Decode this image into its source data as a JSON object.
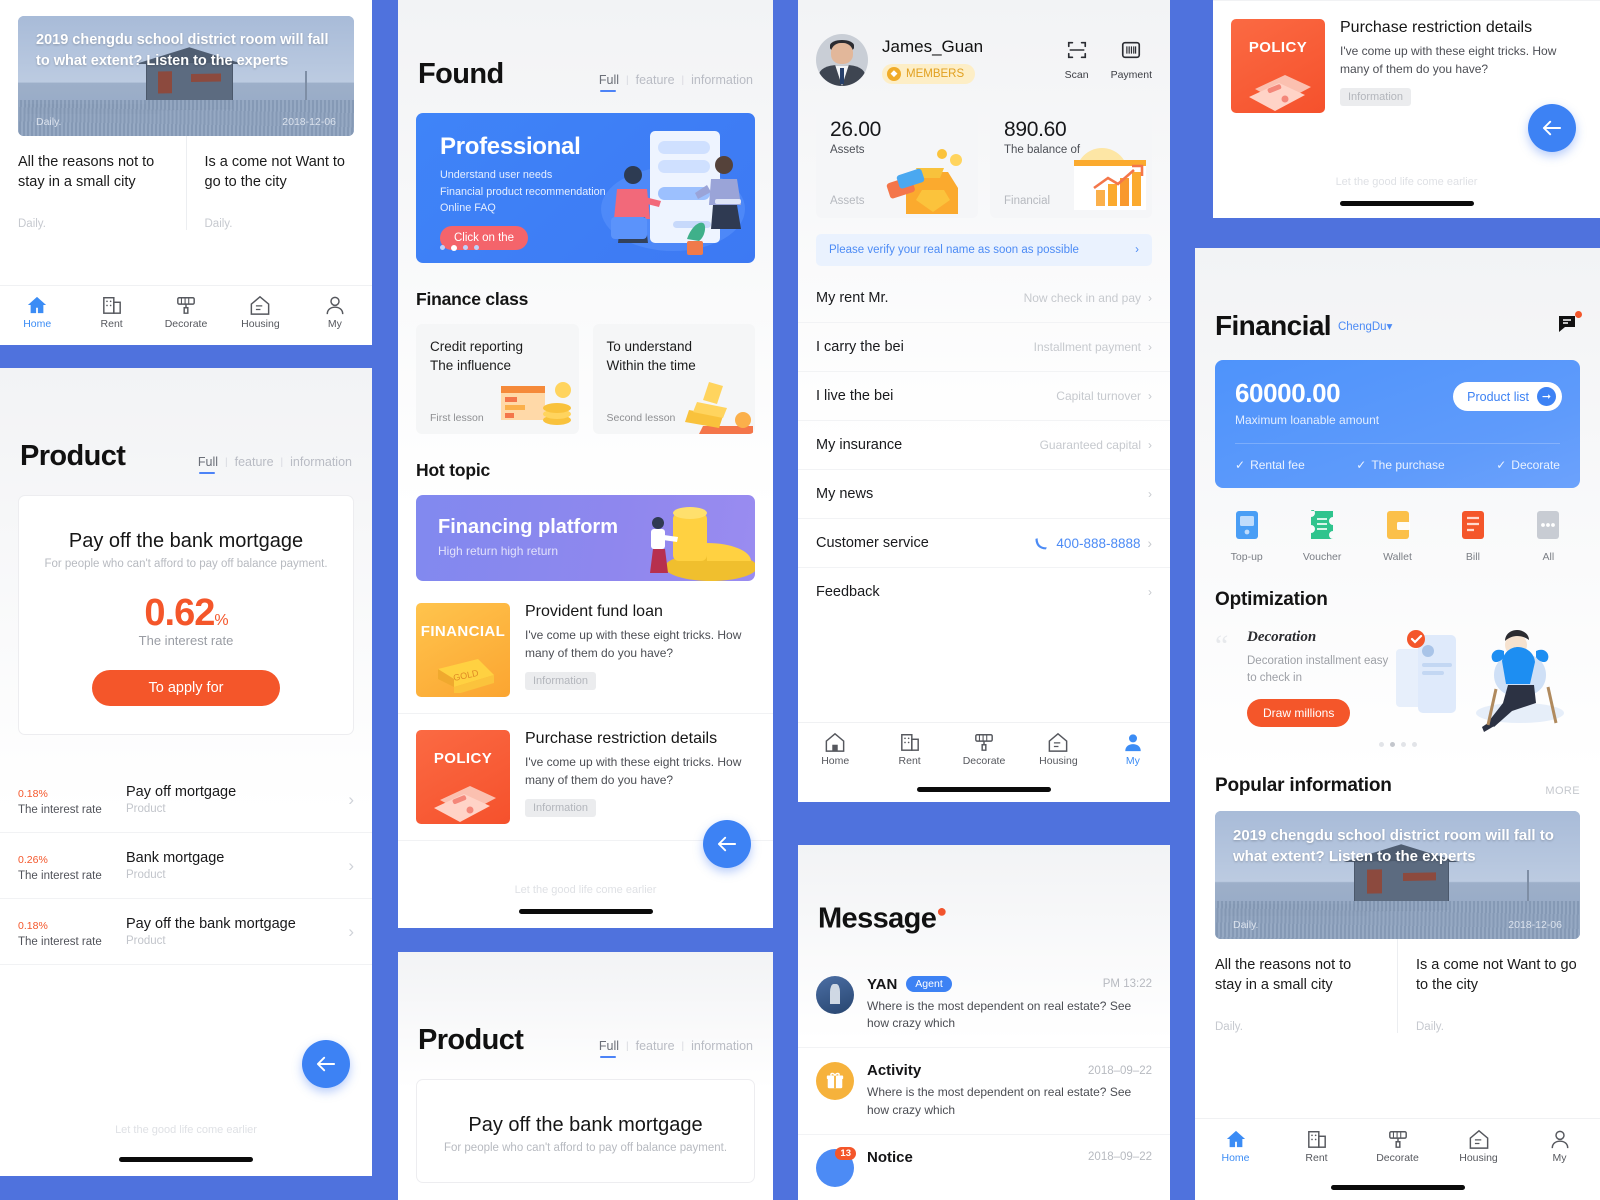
{
  "common": {
    "tabs_full": "Full",
    "tabs_feature": "feature",
    "tabs_information": "information",
    "footnote": "Let the good life come earlier",
    "chevron": "›",
    "back_arrow": "←"
  },
  "bottom_nav": {
    "items": [
      {
        "label": "Home",
        "icon": "home-icon"
      },
      {
        "label": "Rent",
        "icon": "building-icon"
      },
      {
        "label": "Decorate",
        "icon": "paint-roller-icon"
      },
      {
        "label": "Housing",
        "icon": "house-doc-icon"
      },
      {
        "label": "My",
        "icon": "person-icon"
      }
    ],
    "active_home": "Home",
    "active_my": "My"
  },
  "news": {
    "hero_title": "2019 chengdu school district room will fall to what extent? Listen to the experts",
    "hero_source": "Daily.",
    "hero_date": "2018-12-06",
    "items": [
      {
        "title": "All the reasons not to stay in a small city",
        "source": "Daily."
      },
      {
        "title": "Is a come not Want to go to the city",
        "source": "Daily."
      }
    ]
  },
  "product": {
    "title": "Product",
    "card": {
      "name": "Pay off the bank mortgage",
      "desc": "For people who can't afford to pay off balance payment.",
      "rate": "0.62",
      "rate_unit": "%",
      "rate_label": "The interest rate",
      "apply_label": "To apply for"
    },
    "rows": [
      {
        "rate": "0.18",
        "unit": "%",
        "rate_label": "The interest rate",
        "title": "Pay off  mortgage",
        "desc": "Product"
      },
      {
        "rate": "0.26",
        "unit": "%",
        "rate_label": "The interest rate",
        "title": "Bank mortgage",
        "desc": "Product"
      },
      {
        "rate": "0.18",
        "unit": "%",
        "rate_label": "The interest rate",
        "title": "Pay off the bank mortgage",
        "desc": "Product"
      }
    ]
  },
  "found": {
    "title": "Found",
    "banner": {
      "heading": "Professional",
      "line1": "Understand user needs",
      "line2": "Financial product recommendation",
      "line3": "Online FAQ",
      "cta": "Click on the",
      "dots": 4,
      "active_dot": 1
    },
    "finance_class": {
      "heading": "Finance class",
      "cards": [
        {
          "title": "Credit reporting\nThe influence",
          "lesson": "First lesson"
        },
        {
          "title": "To understand\nWithin the time",
          "lesson": "Second lesson"
        }
      ]
    },
    "hot_topic": {
      "heading": "Hot topic",
      "banner_title": "Financing platform",
      "banner_sub": "High return   high return",
      "items": [
        {
          "badge": "FINANCIAL",
          "title": "Provident fund loan",
          "desc": "I've come up with these eight tricks. How many of them do you have?",
          "chip": "Information"
        },
        {
          "badge": "POLICY",
          "title": "Purchase restriction details",
          "desc": "I've come up with these eight tricks. How many of them do you have?",
          "chip": "Information"
        }
      ]
    }
  },
  "profile": {
    "name": "James_Guan",
    "member_badge": "MEMBERS",
    "actions": [
      {
        "label": "Scan",
        "icon": "scan-icon"
      },
      {
        "label": "Payment",
        "icon": "barcode-icon"
      }
    ],
    "assets": [
      {
        "value": "26.00",
        "key": "Assets",
        "foot": "Assets"
      },
      {
        "value": "890.60",
        "key": "The balance of",
        "foot": "Financial"
      }
    ],
    "verify_text": "Please verify your real name as soon as possible",
    "menu": [
      {
        "label": "My rent Mr.",
        "value": "Now check in and pay"
      },
      {
        "label": "I carry the bei",
        "value": "Installment payment"
      },
      {
        "label": "I live the bei",
        "value": "Capital turnover"
      },
      {
        "label": "My insurance",
        "value": "Guaranteed capital"
      },
      {
        "label": "My news",
        "value": ""
      },
      {
        "label": "Customer service",
        "value": "400-888-8888",
        "phone": true
      },
      {
        "label": "Feedback",
        "value": ""
      }
    ]
  },
  "message": {
    "title": "Message",
    "items": [
      {
        "name": "YAN",
        "tag": "Agent",
        "time": "PM 13:22",
        "text": "Where is the most dependent on real estate? See how crazy which",
        "avatar": "photo"
      },
      {
        "name": "Activity",
        "tag": "",
        "time": "2018–09–22",
        "text": "Where is the most dependent on real estate? See how crazy which",
        "avatar": "gift"
      },
      {
        "name": "Notice",
        "tag": "",
        "time": "2018–09–22",
        "text": "",
        "avatar": "notice",
        "badge": "13"
      }
    ]
  },
  "financial": {
    "title": "Financial",
    "city": "ChengDu",
    "city_caret": "▾",
    "loan": {
      "amount": "60000.00",
      "amount_label": "Maximum loanable amount",
      "product_list": "Product list",
      "features": [
        "Rental fee",
        "The purchase",
        "Decorate"
      ]
    },
    "quick": [
      {
        "label": "Top-up",
        "icon": "topup-icon",
        "color": "#4a9ef5"
      },
      {
        "label": "Voucher",
        "icon": "voucher-icon",
        "color": "#2fc48d"
      },
      {
        "label": "Wallet",
        "icon": "wallet-icon",
        "color": "#fbc04a"
      },
      {
        "label": "Bill",
        "icon": "bill-icon",
        "color": "#f4562a"
      },
      {
        "label": "All",
        "icon": "more-icon",
        "color": "#c8ccd3"
      }
    ],
    "optimization": {
      "heading": "Optimization",
      "card_title": "Decoration",
      "card_desc": "Decoration installment easy to check in",
      "cta": "Draw millions",
      "dots": 4,
      "active_dot": 1
    },
    "popular": {
      "heading": "Popular information",
      "more": "MORE"
    }
  }
}
